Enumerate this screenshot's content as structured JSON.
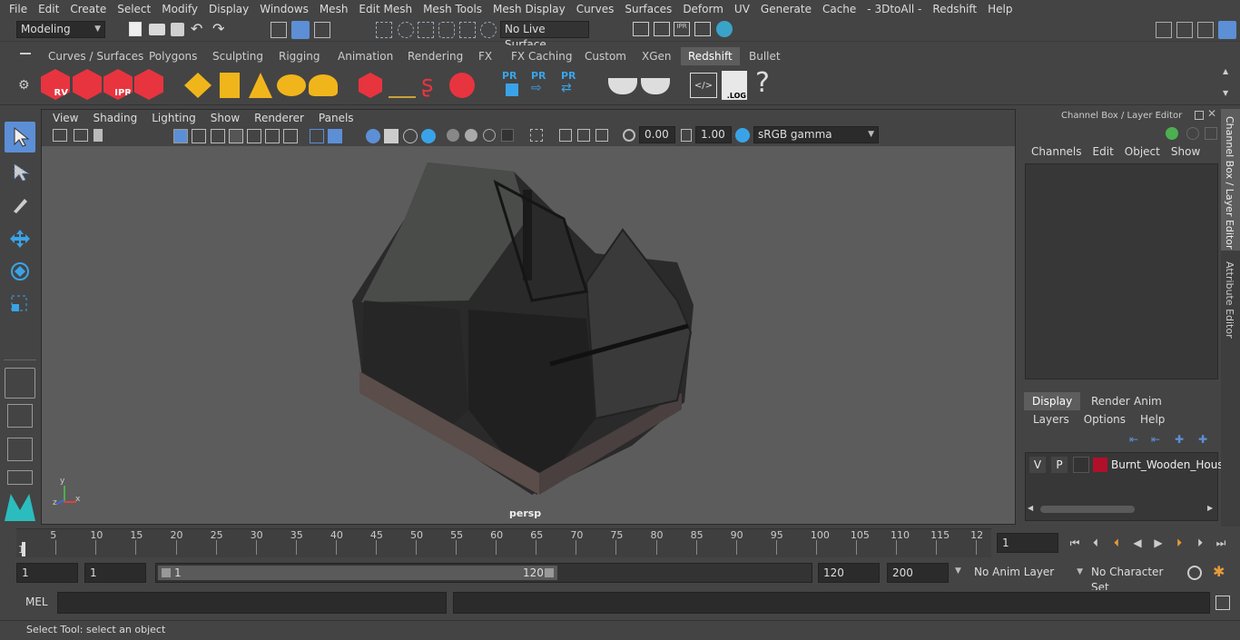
{
  "menu": [
    "File",
    "Edit",
    "Create",
    "Select",
    "Modify",
    "Display",
    "Windows",
    "Mesh",
    "Edit Mesh",
    "Mesh Tools",
    "Mesh Display",
    "Curves",
    "Surfaces",
    "Deform",
    "UV",
    "Generate",
    "Cache",
    "- 3DtoAll -",
    "Redshift",
    "Help"
  ],
  "status": {
    "mode": "Modeling",
    "live_surface": "No Live Surface"
  },
  "shelf_tabs": [
    "Curves / Surfaces",
    "Polygons",
    "Sculpting",
    "Rigging",
    "Animation",
    "Rendering",
    "FX",
    "FX Caching",
    "Custom",
    "XGen",
    "Redshift",
    "Bullet"
  ],
  "active_shelf_tab": "Redshift",
  "shelf_icon_labels": {
    "rv": "RV",
    "ipr": "IPR",
    "pr": "PR",
    "log": ".LOG",
    "help": "?"
  },
  "viewport": {
    "menu": [
      "View",
      "Shading",
      "Lighting",
      "Show",
      "Renderer",
      "Panels"
    ],
    "exposure": "0.00",
    "gamma": "1.00",
    "color_space": "sRGB gamma",
    "camera_label": "persp",
    "axis_labels": {
      "x": "x",
      "y": "y",
      "z": "z"
    }
  },
  "channel_box": {
    "title": "Channel Box / Layer Editor",
    "menu": [
      "Channels",
      "Edit",
      "Object",
      "Show"
    ],
    "layer_tabs": [
      "Display",
      "Render",
      "Anim"
    ],
    "active_layer_tab": "Display",
    "layer_menu": [
      "Layers",
      "Options",
      "Help"
    ],
    "layer": {
      "v": "V",
      "p": "P",
      "name": "Burnt_Wooden_House",
      "color": "#b0102a"
    }
  },
  "side_tabs": [
    "Channel Box / Layer Editor",
    "Attribute Editor"
  ],
  "timeline": {
    "ticks": [
      "1",
      "5",
      "10",
      "15",
      "20",
      "25",
      "30",
      "35",
      "40",
      "45",
      "50",
      "55",
      "60",
      "65",
      "70",
      "75",
      "80",
      "85",
      "90",
      "95",
      "100",
      "105",
      "110",
      "115",
      "12"
    ],
    "current_frame": "1"
  },
  "range": {
    "start": "1",
    "playback_start": "1",
    "slider_start": "1",
    "slider_end": "120",
    "playback_end": "120",
    "end": "200",
    "anim_layer": "No Anim Layer",
    "char_set": "No Character Set"
  },
  "command": {
    "label": "MEL"
  },
  "help_line": "Select Tool: select an object",
  "colors": {
    "accent": "#5d8fd6",
    "redshift": "#e8343f",
    "maya_teal": "#2bbdbd"
  }
}
